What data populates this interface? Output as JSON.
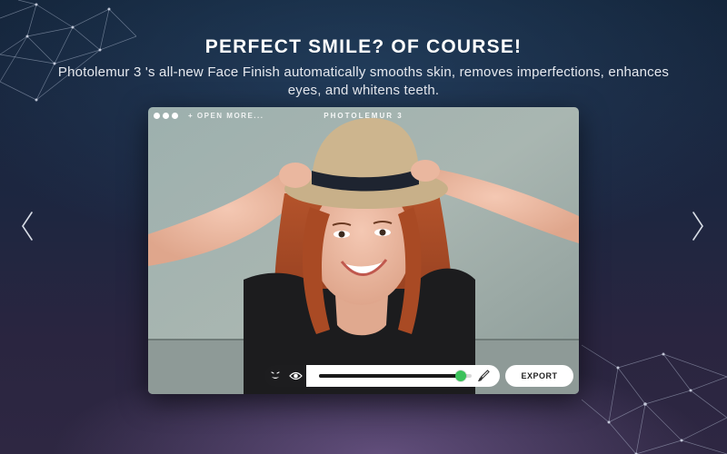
{
  "promo": {
    "headline": "PERFECT SMILE? OF COURSE!",
    "subline": "Photolemur 3 's all-new Face Finish automatically smooths skin, removes imperfections, enhances eyes, and whitens teeth."
  },
  "nav": {
    "prev_icon": "chevron-left-icon",
    "next_icon": "chevron-right-icon"
  },
  "app": {
    "title": "PHOTOLEMUR 3",
    "open_more": "+ OPEN MORE...",
    "window_controls": [
      "dot",
      "dot",
      "dot"
    ],
    "photo_subject": "photo-preview",
    "toolbar": {
      "modes": [
        "face-icon",
        "eye-icon"
      ],
      "slider_value": 0.93,
      "brush_icon": "brush-icon",
      "export_label": "EXPORT"
    }
  },
  "colors": {
    "accent_green": "#3cc15b",
    "toolbar_dark": "#1d1d1f",
    "text_white": "#ffffff"
  }
}
